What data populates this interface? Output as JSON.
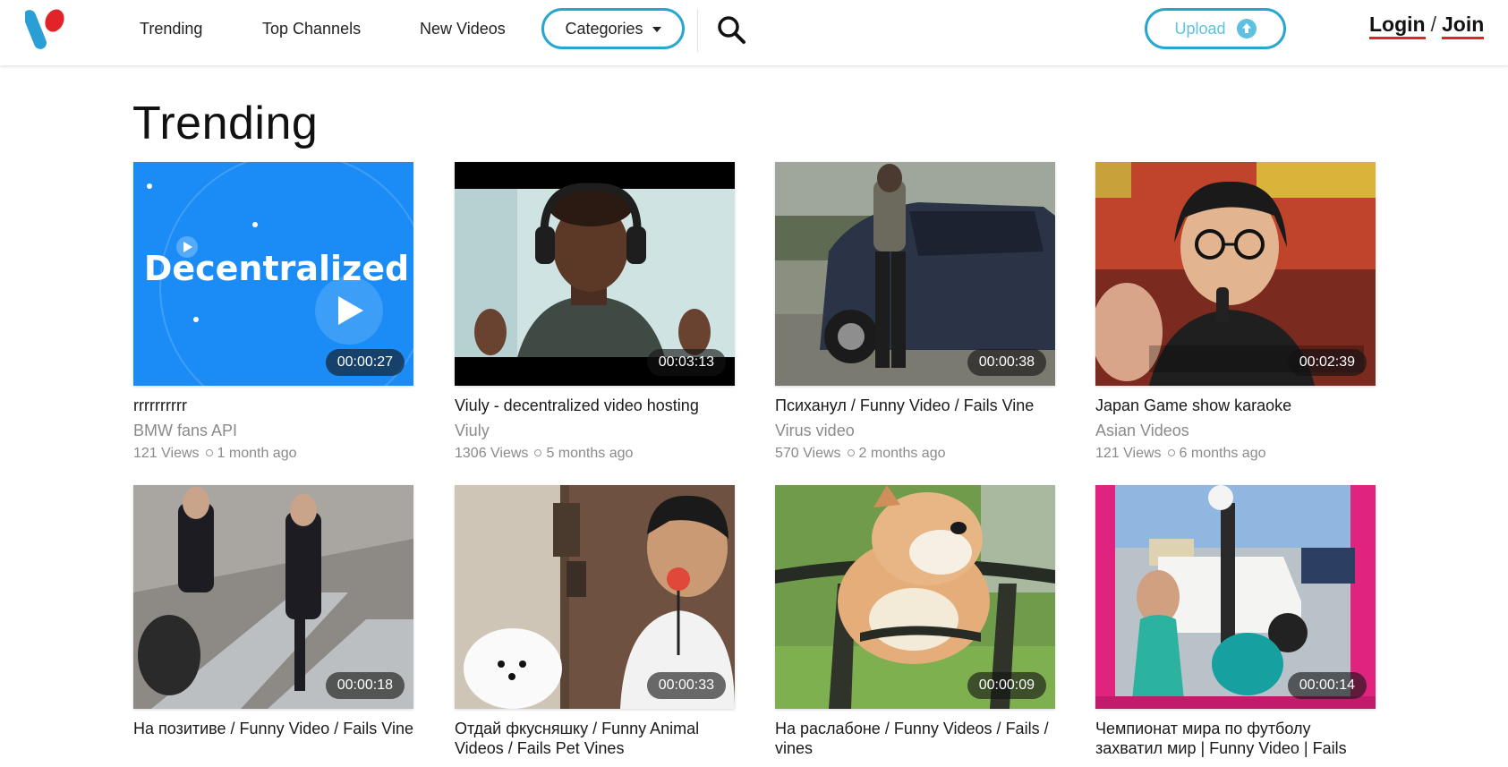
{
  "nav": {
    "trending": "Trending",
    "top_channels": "Top Channels",
    "new_videos": "New Videos",
    "categories": "Categories",
    "upload": "Upload",
    "login": "Login",
    "slash": "/",
    "join": "Join"
  },
  "colors": {
    "accent": "#27a7cf",
    "auth_underline": "#e2242a",
    "logo_blue": "#2a9fd6",
    "logo_red": "#e2242a"
  },
  "page": {
    "title": "Trending"
  },
  "videos": [
    {
      "title": "rrrrrrrrrr",
      "channel": "BMW fans API",
      "views": "121 Views",
      "age": "1 month ago",
      "duration": "00:00:27",
      "thumb_text": "Decentralized"
    },
    {
      "title": "Viuly - decentralized video hosting",
      "channel": "Viuly",
      "views": "1306 Views",
      "age": "5 months ago",
      "duration": "00:03:13"
    },
    {
      "title": "Психанул / Funny Video / Fails Vine",
      "channel": "Virus video",
      "views": "570 Views",
      "age": "2 months ago",
      "duration": "00:00:38"
    },
    {
      "title": "Japan Game show karaoke",
      "channel": "Asian Videos",
      "views": "121 Views",
      "age": "6 months ago",
      "duration": "00:02:39"
    },
    {
      "title": "На позитиве / Funny Video / Fails Vine",
      "duration": "00:00:18"
    },
    {
      "title": "Отдай фкусняшку / Funny Animal Videos / Fails Pet Vines",
      "duration": "00:00:33"
    },
    {
      "title": "На раслабоне / Funny Videos / Fails / vines",
      "duration": "00:00:09"
    },
    {
      "title": "Чемпионат мира по футболу захватил мир | Funny Video | Fails Vine",
      "duration": "00:00:14"
    }
  ]
}
